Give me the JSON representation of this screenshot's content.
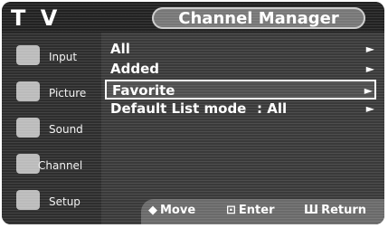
{
  "header": {
    "tv_label": "T V",
    "title": "Channel Manager"
  },
  "sidebar": {
    "items": [
      {
        "label": "Input",
        "icon": "input-icon"
      },
      {
        "label": "Picture",
        "icon": "picture-icon"
      },
      {
        "label": "Sound",
        "icon": "sound-icon"
      },
      {
        "label": "Channel",
        "icon": "channel-icon"
      },
      {
        "label": "Setup",
        "icon": "setup-icon"
      }
    ]
  },
  "menu": {
    "items": [
      {
        "label": "All",
        "value": "",
        "arrow": "►"
      },
      {
        "label": "Added",
        "value": "",
        "arrow": "►"
      },
      {
        "label": "Favorite",
        "value": "",
        "arrow": "►"
      },
      {
        "label": "Default List mode",
        "value": ": All",
        "arrow": "►"
      }
    ]
  },
  "footer": {
    "move_symbol": "◆",
    "move_label": "Move",
    "enter_symbol": "⊡",
    "enter_label": "Enter",
    "return_symbol": "Ш",
    "return_label": "Return"
  }
}
